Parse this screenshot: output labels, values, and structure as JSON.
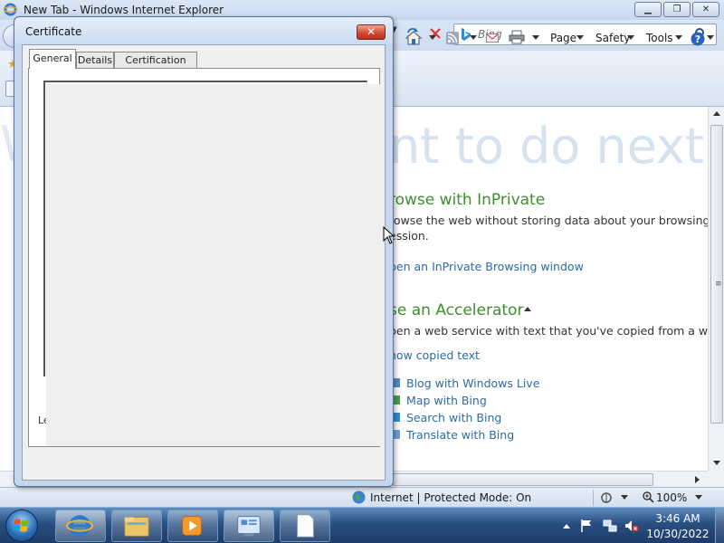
{
  "ie": {
    "title": "New Tab - Windows Internet Explorer",
    "search_placeholder": "Bing",
    "commands": {
      "page": "Page",
      "safety": "Safety",
      "tools": "Tools"
    }
  },
  "content": {
    "bg_text_left": "W",
    "bg_text_right": "nt to do next?",
    "inprivate_heading": "rowse with InPrivate",
    "inprivate_desc_line1": "rowse the web without storing data about your browsing",
    "inprivate_desc_line2": "ession.",
    "inprivate_link": "pen an InPrivate Browsing window",
    "accelerator_heading": "se an Accelerator",
    "accelerator_desc": "pen a web service with text that you've copied from a webp",
    "show_copied": "how copied text",
    "accelerators": [
      "Blog with Windows Live",
      "Map with Bing",
      "Search with Bing",
      "Translate with Bing"
    ]
  },
  "statusbar": {
    "zone": "Internet | Protected Mode: On",
    "zoom": "100%"
  },
  "taskbar": {
    "time": "3:46 AM",
    "date": "10/30/2022"
  },
  "dialog": {
    "title": "Certificate",
    "tabs": [
      "General",
      "Details",
      "Certification Path"
    ],
    "learn_more_fragment": "Le"
  },
  "colors": {
    "accent_green": "#3e8e2e",
    "link_blue": "#2c6aa6",
    "close_red": "#d2452f"
  }
}
